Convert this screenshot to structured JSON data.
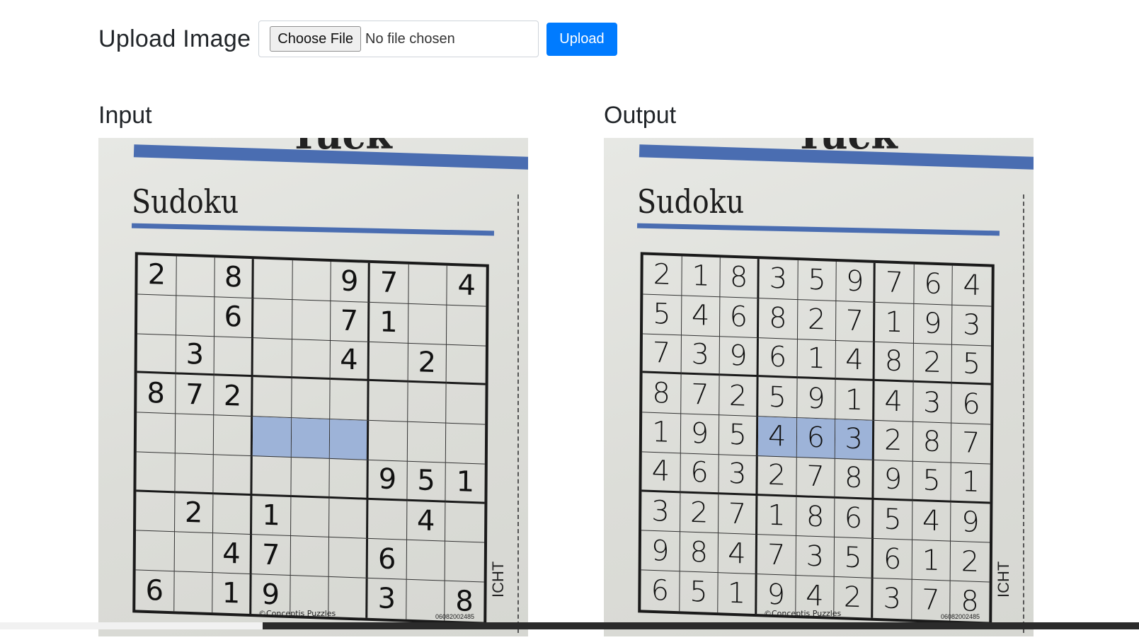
{
  "upload": {
    "title": "Upload Image",
    "choose_label": "Choose File",
    "file_status": "No file chosen",
    "submit_label": "Upload"
  },
  "input_panel": {
    "title": "Input",
    "paper_title": "Sudoku",
    "credit": "©Conceptis Puzzles",
    "code": "06082002485",
    "side_text": "ICHT",
    "grid": [
      [
        "2",
        "",
        "8",
        "",
        "",
        "9",
        "7",
        "",
        "4"
      ],
      [
        "",
        "",
        "6",
        "",
        "",
        "7",
        "1",
        "",
        ""
      ],
      [
        "",
        "3",
        "",
        "",
        "",
        "4",
        "",
        "2",
        ""
      ],
      [
        "8",
        "7",
        "2",
        "",
        "",
        "",
        "",
        "",
        ""
      ],
      [
        "",
        "",
        "",
        "",
        "",
        "",
        "",
        "",
        ""
      ],
      [
        "",
        "",
        "",
        "",
        "",
        "",
        "9",
        "5",
        "1"
      ],
      [
        "",
        "2",
        "",
        "1",
        "",
        "",
        "",
        "4",
        ""
      ],
      [
        "",
        "",
        "4",
        "7",
        "",
        "",
        "6",
        "",
        ""
      ],
      [
        "6",
        "",
        "1",
        "9",
        "",
        "",
        "3",
        "",
        "8"
      ]
    ]
  },
  "output_panel": {
    "title": "Output",
    "paper_title": "Sudoku",
    "credit": "©Conceptis Puzzles",
    "code": "06082002485",
    "side_text": "ICHT",
    "grid": [
      [
        "2",
        "1",
        "8",
        "3",
        "5",
        "9",
        "7",
        "6",
        "4"
      ],
      [
        "5",
        "4",
        "6",
        "8",
        "2",
        "7",
        "1",
        "9",
        "3"
      ],
      [
        "7",
        "3",
        "9",
        "6",
        "1",
        "4",
        "8",
        "2",
        "5"
      ],
      [
        "8",
        "7",
        "2",
        "5",
        "9",
        "1",
        "4",
        "3",
        "6"
      ],
      [
        "1",
        "9",
        "5",
        "4",
        "6",
        "3",
        "2",
        "8",
        "7"
      ],
      [
        "4",
        "6",
        "3",
        "2",
        "7",
        "8",
        "9",
        "5",
        "1"
      ],
      [
        "3",
        "2",
        "7",
        "1",
        "8",
        "6",
        "5",
        "4",
        "9"
      ],
      [
        "9",
        "8",
        "4",
        "7",
        "3",
        "5",
        "6",
        "1",
        "2"
      ],
      [
        "6",
        "5",
        "1",
        "9",
        "4",
        "2",
        "3",
        "7",
        "8"
      ]
    ]
  },
  "colors": {
    "primary": "#007bff",
    "highlight": "#9db3d8",
    "paper_blue": "#4a6db1"
  }
}
